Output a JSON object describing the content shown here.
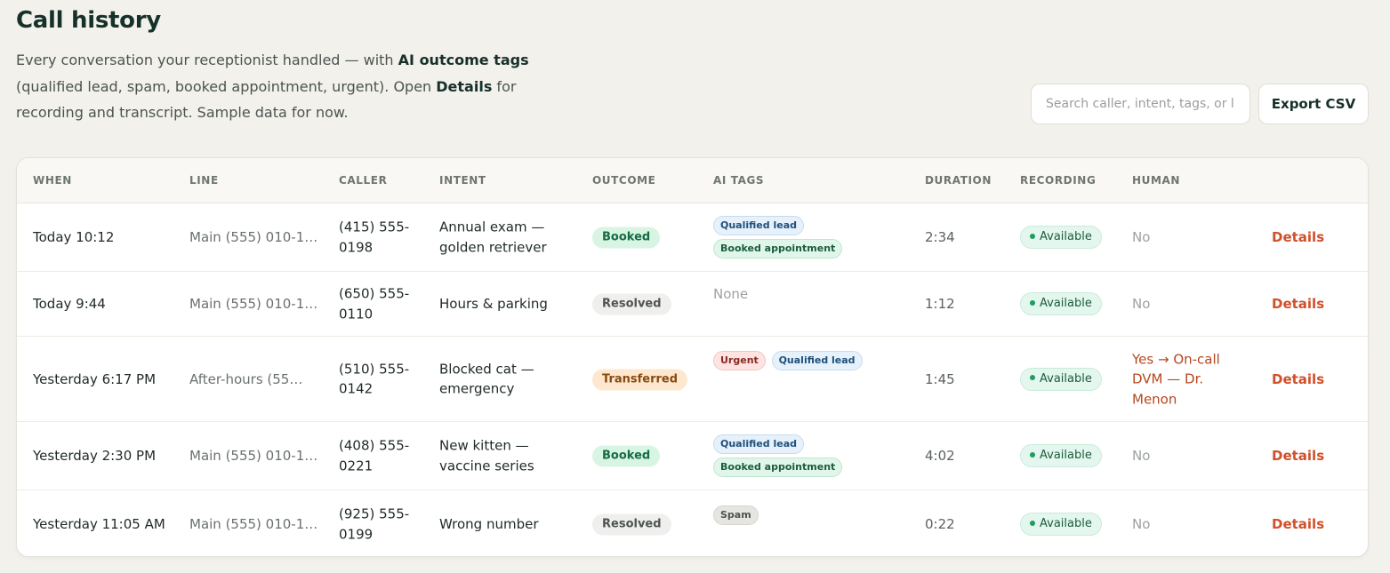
{
  "page": {
    "title": "Call history",
    "subtitle_a": "Every conversation your receptionist handled — with ",
    "subtitle_b": "AI outcome tags",
    "subtitle_c": " (qualified lead, spam, booked appointment, urgent). Open ",
    "subtitle_d": "Details",
    "subtitle_e": " for recording and transcript. Sample data for now."
  },
  "toolbar": {
    "search_placeholder": "Search caller, intent, tags, or line…",
    "export_label": "Export CSV"
  },
  "table": {
    "headers": {
      "when": "WHEN",
      "line": "LINE",
      "caller": "CALLER",
      "intent": "INTENT",
      "outcome": "OUTCOME",
      "ai_tags": "AI TAGS",
      "duration": "DURATION",
      "recording": "RECORDING",
      "human": "HUMAN"
    },
    "rows": [
      {
        "when": "Today 10:12",
        "line": "Main (555) 010-1…",
        "caller": "(415) 555-0198",
        "intent": "Annual exam — golden retriever",
        "outcome": "Booked",
        "tags": [
          "Qualified lead",
          "Booked appointment"
        ],
        "duration": "2:34",
        "recording": "Available",
        "human": "No",
        "details": "Details"
      },
      {
        "when": "Today 9:44",
        "line": "Main (555) 010-1…",
        "caller": "(650) 555-0110",
        "intent": "Hours & parking",
        "outcome": "Resolved",
        "tags_none": "None",
        "duration": "1:12",
        "recording": "Available",
        "human": "No",
        "details": "Details"
      },
      {
        "when": "Yesterday 6:17 PM",
        "line": "After-hours (55…",
        "caller": "(510) 555-0142",
        "intent": "Blocked cat — emergency",
        "outcome": "Transferred",
        "tags": [
          "Urgent",
          "Qualified lead"
        ],
        "duration": "1:45",
        "recording": "Available",
        "human": "Yes → On-call DVM — Dr. Menon",
        "details": "Details"
      },
      {
        "when": "Yesterday 2:30 PM",
        "line": "Main (555) 010-1…",
        "caller": "(408) 555-0221",
        "intent": "New kitten — vaccine series",
        "outcome": "Booked",
        "tags": [
          "Qualified lead",
          "Booked appointment"
        ],
        "duration": "4:02",
        "recording": "Available",
        "human": "No",
        "details": "Details"
      },
      {
        "when": "Yesterday 11:05 AM",
        "line": "Main (555) 010-1…",
        "caller": "(925) 555-0199",
        "intent": "Wrong number",
        "outcome": "Resolved",
        "tags": [
          "Spam"
        ],
        "duration": "0:22",
        "recording": "Available",
        "human": "No",
        "details": "Details"
      }
    ]
  },
  "colors": {
    "background": "#f3f1ec",
    "accent_link": "#d0502b",
    "booked": "#d8f5e4",
    "transferred": "#fde8cf",
    "recording_dot": "#1f9c5f"
  }
}
